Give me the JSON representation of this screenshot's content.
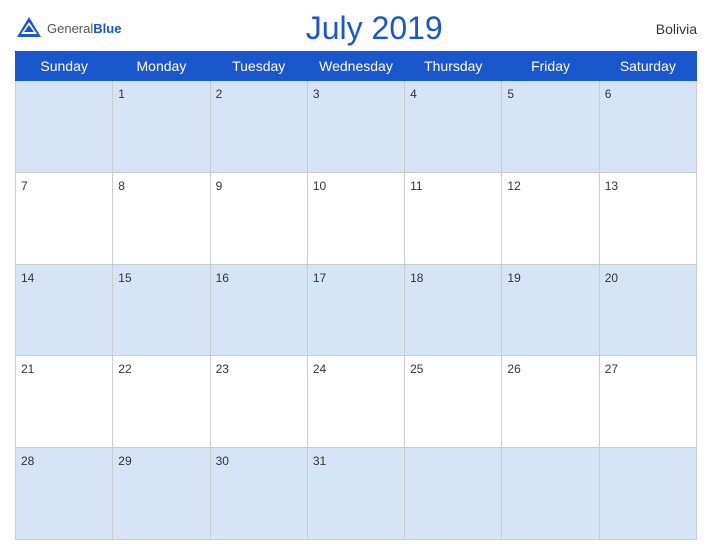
{
  "header": {
    "logo_general": "General",
    "logo_blue": "Blue",
    "title": "July 2019",
    "country": "Bolivia"
  },
  "weekdays": [
    "Sunday",
    "Monday",
    "Tuesday",
    "Wednesday",
    "Thursday",
    "Friday",
    "Saturday"
  ],
  "weeks": [
    [
      {
        "num": "",
        "empty": true
      },
      {
        "num": "1"
      },
      {
        "num": "2"
      },
      {
        "num": "3"
      },
      {
        "num": "4"
      },
      {
        "num": "5"
      },
      {
        "num": "6"
      }
    ],
    [
      {
        "num": "7"
      },
      {
        "num": "8"
      },
      {
        "num": "9"
      },
      {
        "num": "10"
      },
      {
        "num": "11"
      },
      {
        "num": "12"
      },
      {
        "num": "13"
      }
    ],
    [
      {
        "num": "14"
      },
      {
        "num": "15"
      },
      {
        "num": "16"
      },
      {
        "num": "17"
      },
      {
        "num": "18"
      },
      {
        "num": "19"
      },
      {
        "num": "20"
      }
    ],
    [
      {
        "num": "21"
      },
      {
        "num": "22"
      },
      {
        "num": "23"
      },
      {
        "num": "24"
      },
      {
        "num": "25"
      },
      {
        "num": "26"
      },
      {
        "num": "27"
      }
    ],
    [
      {
        "num": "28"
      },
      {
        "num": "29"
      },
      {
        "num": "30"
      },
      {
        "num": "31"
      },
      {
        "num": ""
      },
      {
        "num": ""
      },
      {
        "num": ""
      }
    ]
  ],
  "colors": {
    "dark_row": "#d6e4f7",
    "header_blue": "#1a56cc"
  }
}
